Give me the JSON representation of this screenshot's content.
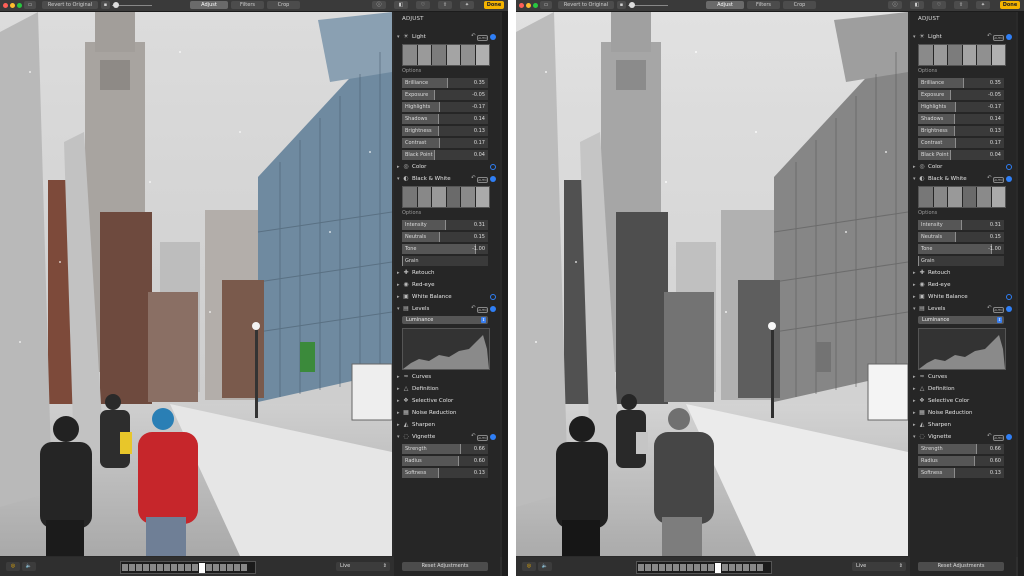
{
  "toolbar": {
    "revert": "Revert to Original",
    "tabs": [
      "Adjust",
      "Filters",
      "Crop"
    ],
    "done": "Done"
  },
  "panel": {
    "title": "ADJUST",
    "auto": "AUTO",
    "options": "Options",
    "light": {
      "label": "Light",
      "rows": [
        {
          "name": "Brilliance",
          "value": "0.35"
        },
        {
          "name": "Exposure",
          "value": "-0.05"
        },
        {
          "name": "Highlights",
          "value": "-0.17"
        },
        {
          "name": "Shadows",
          "value": "0.14"
        },
        {
          "name": "Brightness",
          "value": "0.13"
        },
        {
          "name": "Contrast",
          "value": "0.17"
        },
        {
          "name": "Black Point",
          "value": "0.04"
        }
      ]
    },
    "color": {
      "label": "Color"
    },
    "bw": {
      "label": "Black & White",
      "rows": [
        {
          "name": "Intensity",
          "value": "0.31"
        },
        {
          "name": "Neutrals",
          "value": "0.15"
        },
        {
          "name": "Tone",
          "value": "-1.00"
        },
        {
          "name": "Grain",
          "value": ""
        }
      ]
    },
    "sections_mid": [
      "Retouch",
      "Red-eye",
      "White Balance"
    ],
    "levels": {
      "label": "Levels",
      "dropdown": "Luminance"
    },
    "sections_lower": [
      "Curves",
      "Definition",
      "Selective Color",
      "Noise Reduction",
      "Sharpen"
    ],
    "vignette": {
      "label": "Vignette",
      "rows": [
        {
          "name": "Strength",
          "value": "0.66"
        },
        {
          "name": "Radius",
          "value": "0.60"
        },
        {
          "name": "Softness",
          "value": "0.13"
        }
      ]
    },
    "reset": "Reset Adjustments"
  },
  "bottombar": {
    "live": "Live"
  },
  "colors": {
    "accent": "#2f7ff6",
    "done": "#f5b400",
    "panel": "#262626"
  }
}
